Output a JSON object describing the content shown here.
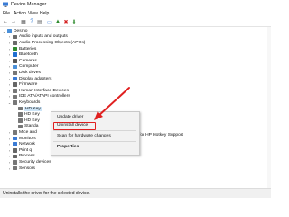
{
  "window": {
    "title": "Device Manager"
  },
  "menu": [
    "File",
    "Action",
    "View",
    "Help"
  ],
  "toolbar": [
    {
      "icon": "back-arrow-icon",
      "glyph": "←"
    },
    {
      "icon": "forward-arrow-icon",
      "glyph": "→"
    },
    {
      "icon": "properties-icon",
      "glyph": "▦"
    },
    {
      "icon": "help-icon",
      "glyph": "?"
    },
    {
      "icon": "update-driver-icon",
      "glyph": "▤"
    },
    {
      "icon": "monitor-icon",
      "glyph": "▭"
    },
    {
      "icon": "enable-device-icon",
      "glyph": "▲"
    },
    {
      "icon": "uninstall-icon",
      "glyph": "✖"
    },
    {
      "icon": "scan-hardware-icon",
      "glyph": "⬇"
    }
  ],
  "tree": {
    "root": "Desmo",
    "items": [
      {
        "label": "Audio inputs and outputs",
        "color": "#6b6b6b"
      },
      {
        "label": "Audio Processing Objects (APOs)",
        "color": "#6b6b6b"
      },
      {
        "label": "Batteries",
        "color": "#2e8b2e"
      },
      {
        "label": "Bluetooth",
        "color": "#1f6fd1"
      },
      {
        "label": "Cameras",
        "color": "#555"
      },
      {
        "label": "Computer",
        "color": "#4a90d9"
      },
      {
        "label": "Disk drives",
        "color": "#777"
      },
      {
        "label": "Display adapters",
        "color": "#3a7bd5"
      },
      {
        "label": "Firmware",
        "color": "#666"
      },
      {
        "label": "Human Interface Devices",
        "color": "#777"
      },
      {
        "label": "IDE ATA/ATAPI controllers",
        "color": "#777"
      },
      {
        "label": "Keyboards",
        "color": "#777"
      }
    ],
    "keyboard_children": [
      {
        "label": "HD Key",
        "selected": true
      },
      {
        "label": "HD Key",
        "selected": false
      },
      {
        "label": "HD Key",
        "selected": false
      },
      {
        "label": "Standa",
        "selected": false
      },
      {
        "label": "Mice and",
        "selected": false
      },
      {
        "label": "Monitors",
        "selected": false
      },
      {
        "label": "Network",
        "selected": false
      },
      {
        "label": "Print q",
        "selected": false
      },
      {
        "label": "Process",
        "selected": false
      },
      {
        "label": "Security devices",
        "selected": false
      },
      {
        "label": "Sensors",
        "selected": false
      }
    ],
    "extra_text": "for HP Hotkey Support"
  },
  "context_menu": {
    "items": [
      "Update driver",
      "Uninstall device",
      "Scan for hardware changes",
      "Properties"
    ],
    "highlighted": "Uninstall device",
    "annotation_color": "#e02020"
  },
  "status": "Uninstalls the driver for the selected device."
}
